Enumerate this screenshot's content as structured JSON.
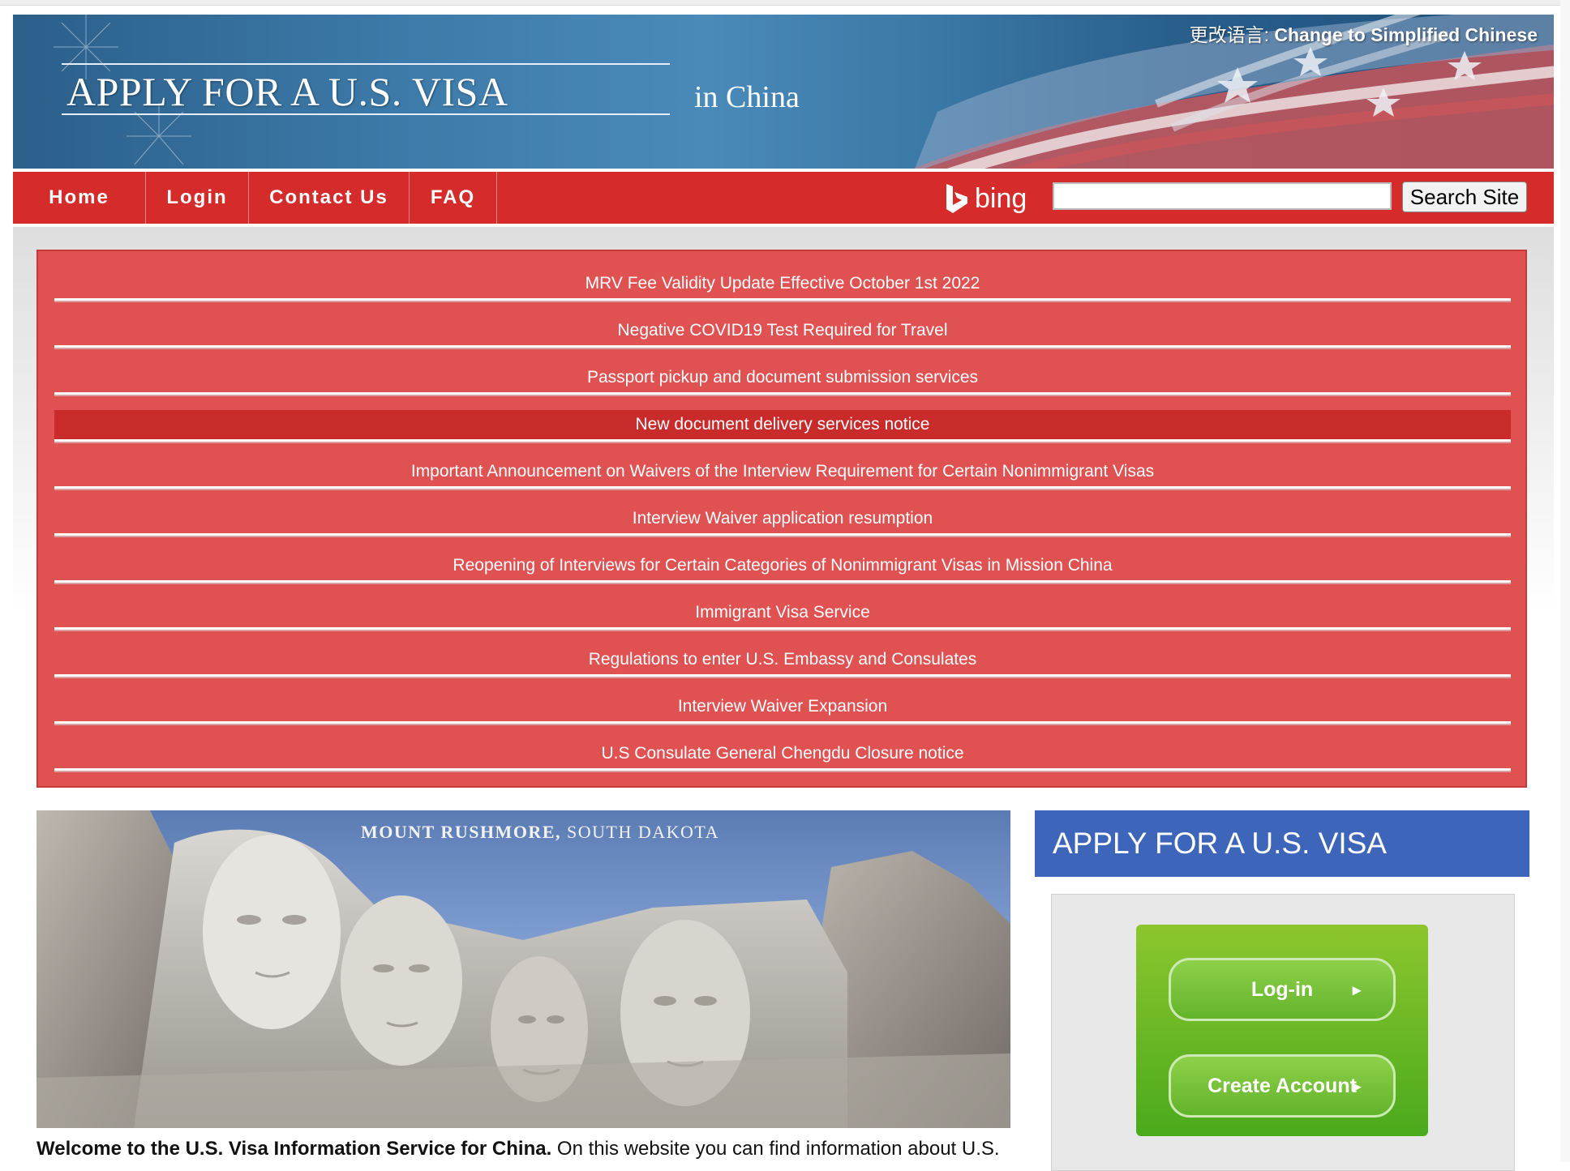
{
  "header": {
    "title": "APPLY FOR A U.S. VISA",
    "subtitle": "in China",
    "language_prefix": "更改语言: ",
    "language_link": "Change to Simplified Chinese"
  },
  "nav": {
    "items": [
      "Home",
      "Login",
      "Contact Us",
      "FAQ"
    ],
    "search_brand": "bing",
    "search_value": "",
    "search_button": "Search Site"
  },
  "announcements": {
    "active_index": 3,
    "items": [
      "MRV Fee Validity Update Effective October 1st 2022",
      "Negative COVID19 Test Required for Travel",
      "Passport pickup and document submission services",
      "New document delivery services notice",
      "Important Announcement on Waivers of the Interview Requirement for Certain Nonimmigrant Visas",
      "Interview Waiver application resumption",
      "Reopening of Interviews for Certain Categories of Nonimmigrant Visas in Mission China",
      "Immigrant Visa Service",
      "Regulations to enter U.S. Embassy and Consulates",
      "Interview Waiver Expansion",
      "U.S Consulate General Chengdu Closure notice"
    ]
  },
  "hero": {
    "caption_bold": "MOUNT RUSHMORE,",
    "caption_rest": " SOUTH DAKOTA"
  },
  "welcome": {
    "bold": "Welcome to the U.S. Visa Information Service for China.",
    "rest": " On this website you can find information about U.S."
  },
  "apply_panel": {
    "heading": "APPLY FOR A U.S. VISA",
    "login_label": "Log-in",
    "create_label": "Create Account"
  },
  "colors": {
    "nav_red": "#d52b2b",
    "announcement_red": "#e05252",
    "active_red": "#c92a2a",
    "apply_blue": "#3d65ba",
    "button_green": "#6cb82c"
  }
}
